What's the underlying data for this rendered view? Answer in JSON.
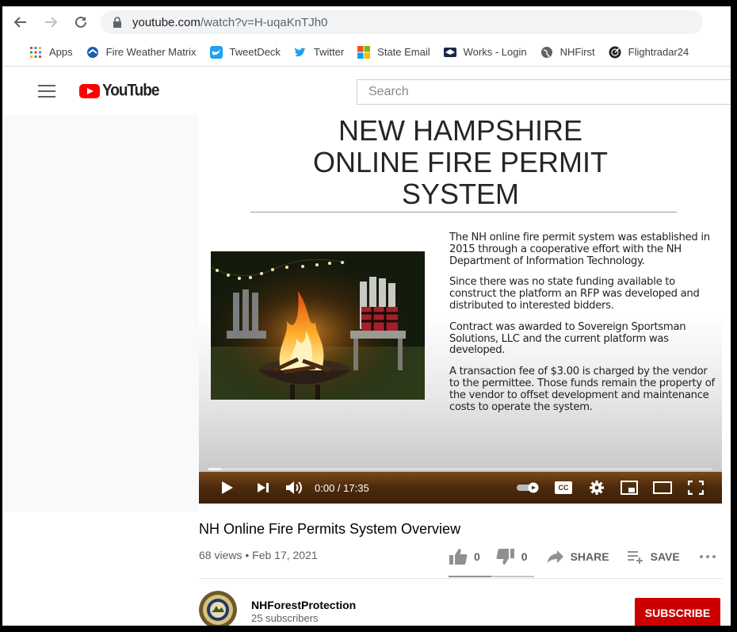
{
  "browser": {
    "url_host": "youtube.com",
    "url_path": "/watch?v=H-uqaKnTJh0"
  },
  "bookmarks": [
    {
      "label": "Apps",
      "icon": "apps-grid-icon"
    },
    {
      "label": "Fire Weather Matrix",
      "icon": "noaa-icon"
    },
    {
      "label": "TweetDeck",
      "icon": "tweetdeck-icon"
    },
    {
      "label": "Twitter",
      "icon": "twitter-icon"
    },
    {
      "label": "State Email",
      "icon": "microsoft-icon"
    },
    {
      "label": "Works - Login",
      "icon": "works-icon"
    },
    {
      "label": "NHFirst",
      "icon": "globe-icon"
    },
    {
      "label": "Flightradar24",
      "icon": "flightradar-icon"
    }
  ],
  "youtube": {
    "logo_text": "YouTube",
    "search_placeholder": "Search"
  },
  "slide": {
    "title_lines": [
      "NEW HAMPSHIRE",
      "ONLINE FIRE PERMIT",
      "SYSTEM"
    ],
    "paragraphs": [
      "The NH online fire permit system was established in 2015 through a cooperative effort with the NH Department of Information Technology.",
      "Since there was no state funding available to construct the platform an RFP was developed and distributed to interested bidders.",
      "Contract was awarded to Sovereign Sportsman Solutions, LLC  and the current platform was developed.",
      "A transaction fee of $3.00 is charged by the vendor to the permittee.  Those funds remain the property of the vendor to offset development and maintenance costs to operate the system."
    ]
  },
  "player": {
    "time": "0:00 / 17:35",
    "cc_label": "CC",
    "accent": "#5a3310"
  },
  "video": {
    "title": "NH Online Fire Permits System Overview",
    "meta": "68 views • Feb 17, 2021",
    "likes": "0",
    "dislikes": "0",
    "share_label": "SHARE",
    "save_label": "SAVE"
  },
  "channel": {
    "name": "NHForestProtection",
    "subscribers": "25 subscribers",
    "subscribe_label": "SUBSCRIBE",
    "subscribe_color": "#cc0000"
  }
}
